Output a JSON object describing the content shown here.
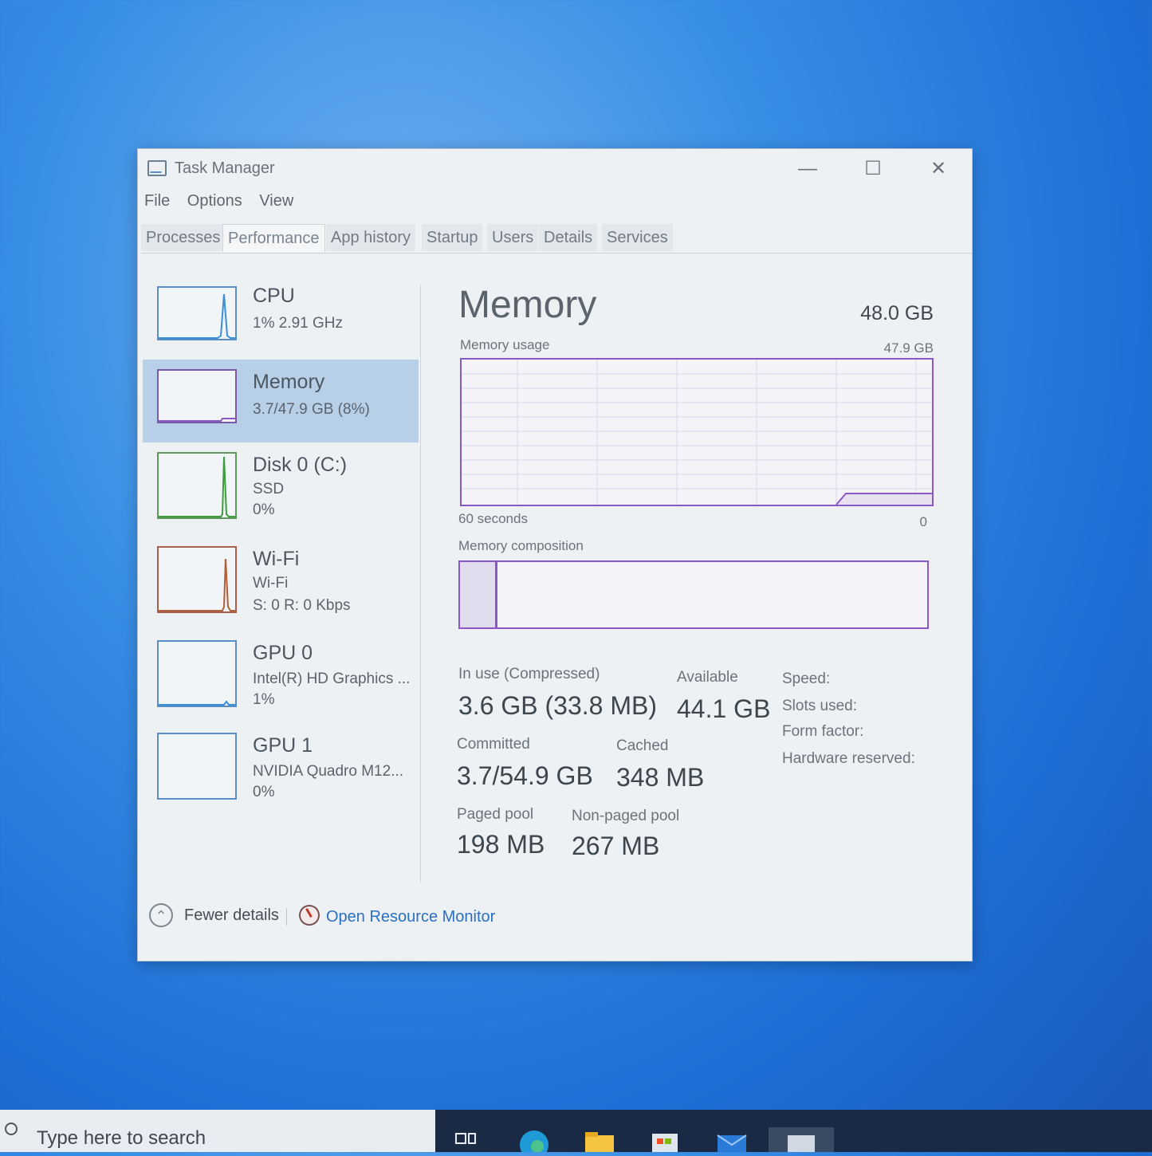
{
  "window": {
    "title": "Task Manager",
    "controls": {
      "minimize": "—",
      "maximize": "☐",
      "close": "✕"
    }
  },
  "menu": [
    "File",
    "Options",
    "View"
  ],
  "tabs": [
    "Processes",
    "Performance",
    "App history",
    "Startup",
    "Users",
    "Details",
    "Services"
  ],
  "active_tab": "Performance",
  "sidebar": [
    {
      "title": "CPU",
      "line1": "1%  2.91 GHz",
      "line2": "",
      "color": "#3a8fd6"
    },
    {
      "title": "Memory",
      "line1": "3.7/47.9 GB (8%)",
      "line2": "",
      "color": "#8a57c7",
      "selected": true
    },
    {
      "title": "Disk 0 (C:)",
      "line1": "SSD",
      "line2": "0%",
      "color": "#3e9b3e"
    },
    {
      "title": "Wi-Fi",
      "line1": "Wi-Fi",
      "line2": "S: 0  R: 0 Kbps",
      "color": "#b0603a"
    },
    {
      "title": "GPU 0",
      "line1": "Intel(R) HD Graphics ...",
      "line2": "1%",
      "color": "#3a8fd6"
    },
    {
      "title": "GPU 1",
      "line1": "NVIDIA Quadro M12...",
      "line2": "0%",
      "color": "#3a8fd6"
    }
  ],
  "memory": {
    "title": "Memory",
    "total": "48.0 GB",
    "usage_label": "Memory usage",
    "usage_max": "47.9 GB",
    "time_label": "60 seconds",
    "time_end": "0",
    "composition_label": "Memory composition",
    "composition_used_fraction": 0.08,
    "stats": {
      "in_use_label": "In use (Compressed)",
      "in_use_value": "3.6 GB (33.8 MB)",
      "available_label": "Available",
      "available_value": "44.1 GB",
      "committed_label": "Committed",
      "committed_value": "3.7/54.9 GB",
      "cached_label": "Cached",
      "cached_value": "348 MB",
      "paged_label": "Paged pool",
      "paged_value": "198 MB",
      "nonpaged_label": "Non-paged pool",
      "nonpaged_value": "267 MB"
    },
    "right_labels": [
      "Speed:",
      "Slots used:",
      "Form factor:",
      "Hardware reserved:"
    ]
  },
  "footer": {
    "fewer_details": "Fewer details",
    "resource_monitor": "Open Resource Monitor"
  },
  "taskbar": {
    "search_placeholder": "Type here to search"
  }
}
